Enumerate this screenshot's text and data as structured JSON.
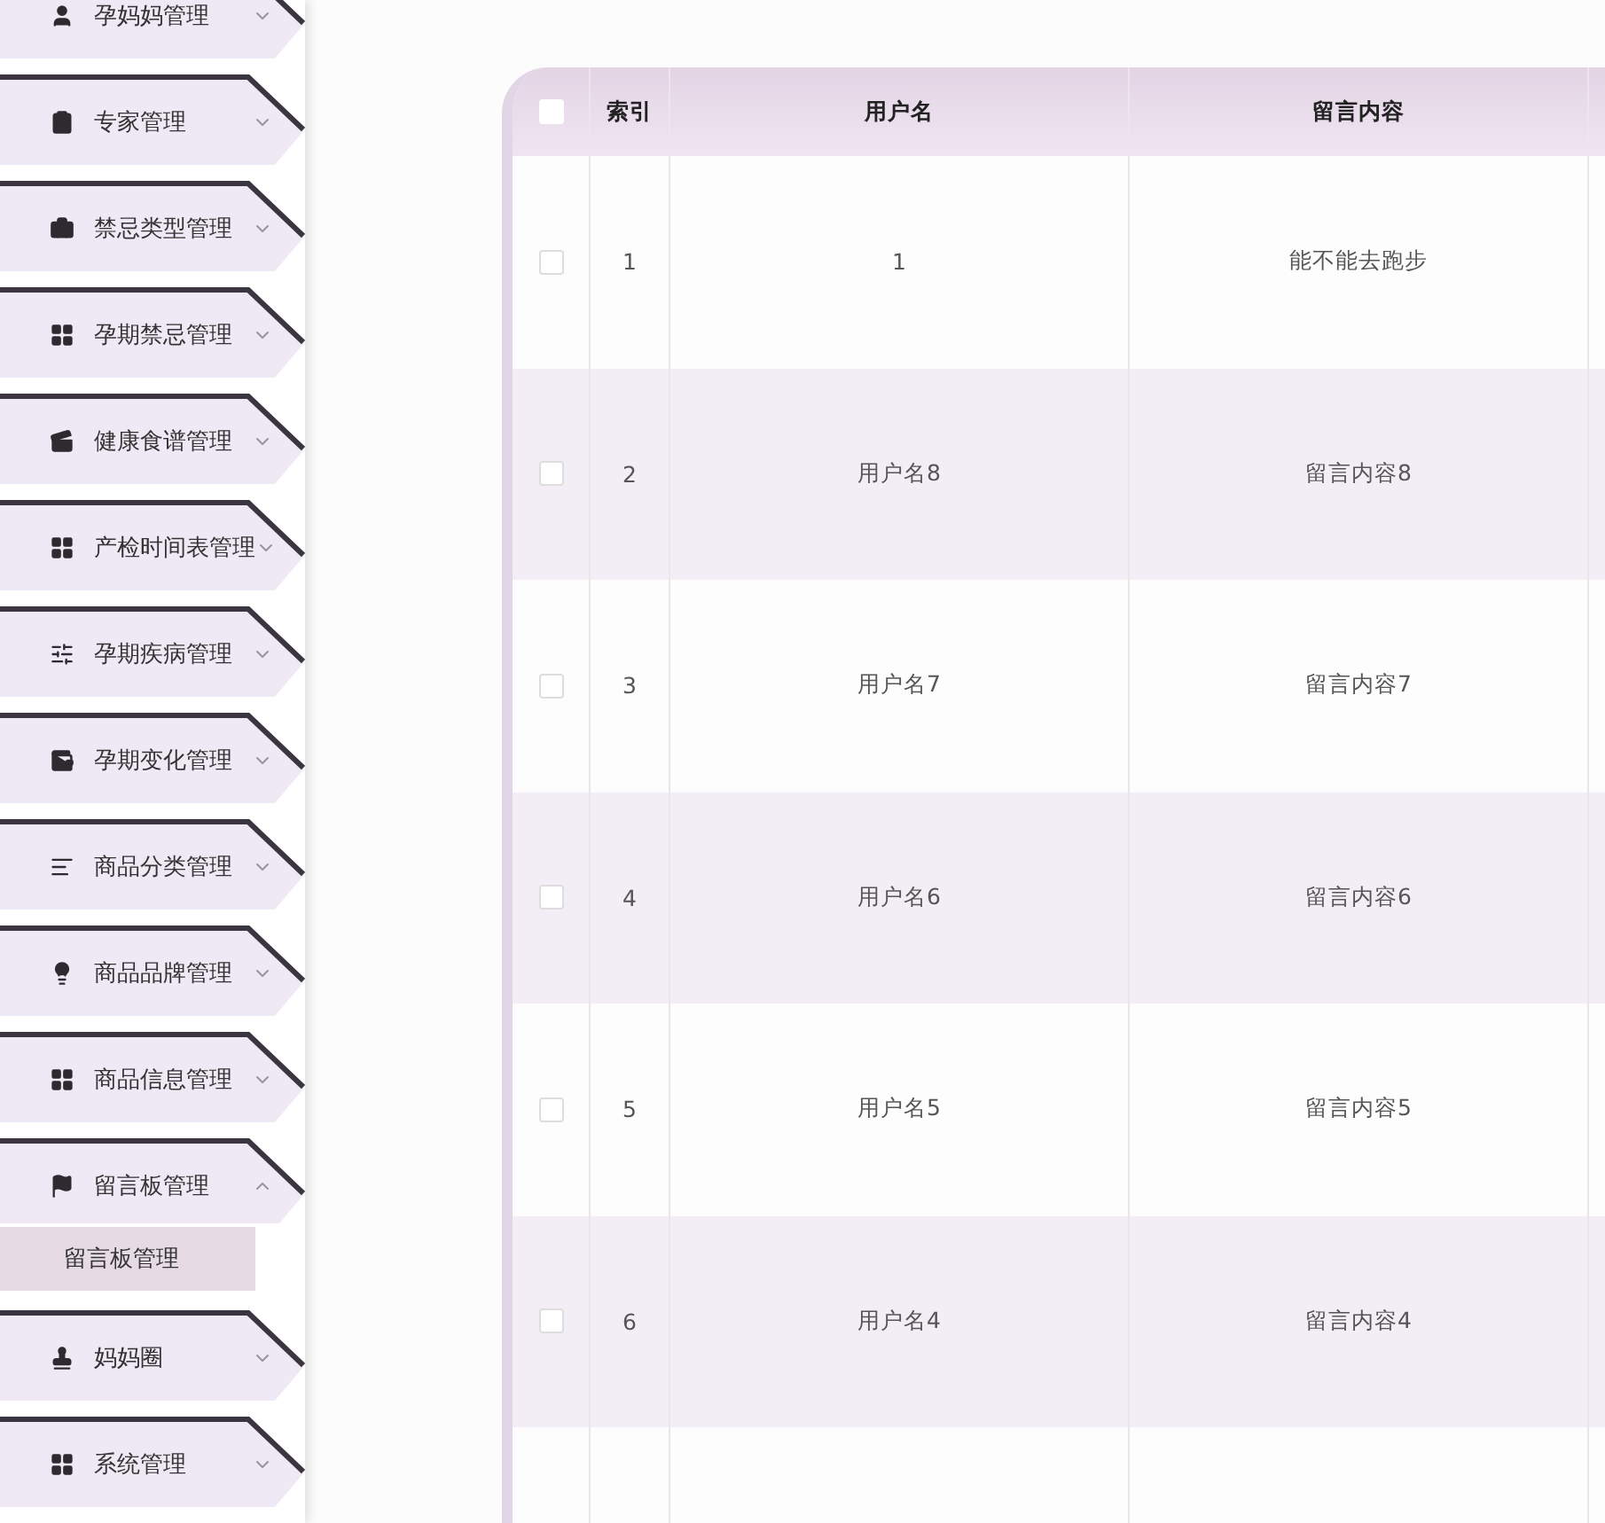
{
  "sidebar": {
    "items": [
      {
        "label": "孕妈妈管理",
        "expanded": false
      },
      {
        "label": "专家管理",
        "expanded": false
      },
      {
        "label": "禁忌类型管理",
        "expanded": false
      },
      {
        "label": "孕期禁忌管理",
        "expanded": false
      },
      {
        "label": "健康食谱管理",
        "expanded": false
      },
      {
        "label": "产检时间表管理",
        "expanded": false
      },
      {
        "label": "孕期疾病管理",
        "expanded": false
      },
      {
        "label": "孕期变化管理",
        "expanded": false
      },
      {
        "label": "商品分类管理",
        "expanded": false
      },
      {
        "label": "商品品牌管理",
        "expanded": false
      },
      {
        "label": "商品信息管理",
        "expanded": false
      },
      {
        "label": "留言板管理",
        "expanded": true,
        "children": [
          {
            "label": "留言板管理",
            "selected": true
          }
        ]
      },
      {
        "label": "妈妈圈",
        "expanded": false
      },
      {
        "label": "系统管理",
        "expanded": false
      }
    ]
  },
  "table": {
    "header_checked": false,
    "columns": [
      "索引",
      "用户名",
      "留言内容"
    ],
    "rows": [
      {
        "checked": false,
        "cells": [
          "1",
          "1",
          "能不能去跑步"
        ]
      },
      {
        "checked": false,
        "cells": [
          "2",
          "用户名8",
          "留言内容8"
        ]
      },
      {
        "checked": false,
        "cells": [
          "3",
          "用户名7",
          "留言内容7"
        ]
      },
      {
        "checked": false,
        "cells": [
          "4",
          "用户名6",
          "留言内容6"
        ]
      },
      {
        "checked": false,
        "cells": [
          "5",
          "用户名5",
          "留言内容5"
        ]
      },
      {
        "checked": false,
        "cells": [
          "6",
          "用户名4",
          "留言内容4"
        ]
      }
    ]
  }
}
